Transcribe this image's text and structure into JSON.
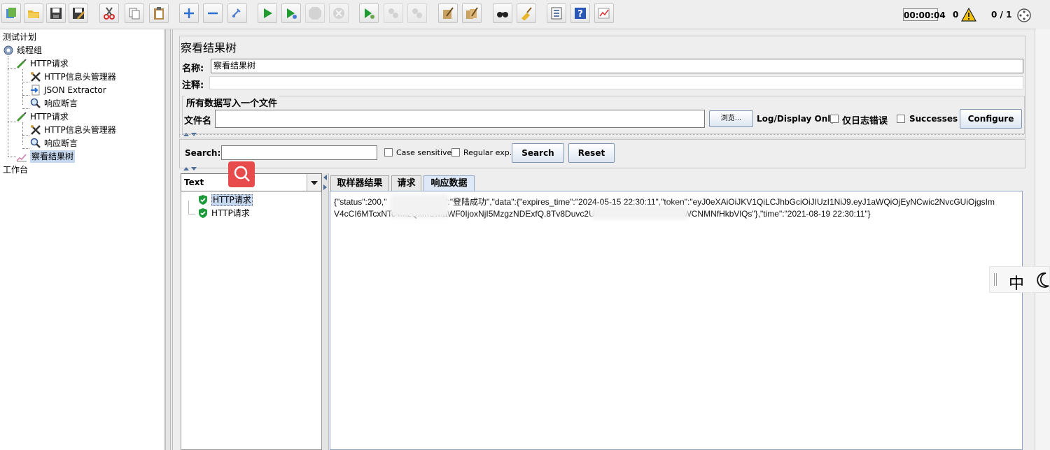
{
  "toolbar": {
    "buttons": [
      "new-icon",
      "open-icon",
      "save-icon",
      "save-as-icon",
      "cut-icon",
      "copy-icon",
      "paste-icon",
      "expand-icon",
      "collapse-icon",
      "toggle-icon",
      "start-icon",
      "start-no-pause-icon",
      "stop-icon",
      "shutdown-icon",
      "remote-start-icon",
      "remote-stop-icon",
      "remote-shutdown-icon",
      "clear-icon",
      "clear-all-icon",
      "search-icon",
      "reset-search-icon",
      "function-helper-icon",
      "help-icon",
      "log-viewer-icon"
    ],
    "timer": "00:00:04",
    "error_count": "0",
    "threads": "0 / 1"
  },
  "tree": {
    "items": [
      {
        "label": "测试计划",
        "icon": "test-plan-icon"
      },
      {
        "label": "线程组",
        "icon": "gear-icon"
      },
      {
        "label": "HTTP请求",
        "icon": "pipette-icon"
      },
      {
        "label": "HTTP信息头管理器",
        "icon": "tools-icon"
      },
      {
        "label": "JSON Extractor",
        "icon": "arrow-doc-icon"
      },
      {
        "label": "响应断言",
        "icon": "magnifier-icon"
      },
      {
        "label": "HTTP请求",
        "icon": "pipette-icon"
      },
      {
        "label": "HTTP信息头管理器",
        "icon": "tools-icon"
      },
      {
        "label": "响应断言",
        "icon": "magnifier-icon"
      },
      {
        "label": "察看结果树",
        "icon": "chart-icon"
      },
      {
        "label": "工作台",
        "icon": ""
      }
    ]
  },
  "panel": {
    "title": "察看结果树",
    "name_label": "名称:",
    "name_value": "察看结果树",
    "comment_label": "注释:",
    "file_section": "所有数据写入一个文件",
    "filename_label": "文件名",
    "browse_label": "浏览...",
    "log_only_label": "Log/Display Only:",
    "errors_only_label": "仅日志错误",
    "successes_label": "Successes",
    "configure_label": "Configure"
  },
  "search": {
    "label": "Search:",
    "case_label": "Case sensitive",
    "regex_label": "Regular exp.",
    "search_btn": "Search",
    "reset_btn": "Reset"
  },
  "results": {
    "renderer": "Text",
    "samples": [
      "HTTP请求",
      "HTTP请求"
    ],
    "tabs": [
      "取样器结果",
      "请求",
      "响应数据"
    ],
    "response_line1": "{\"status\":200,\"                  msg\":\"登陆成功\",\"data\":{\"expires_time\":\"2024-05-15 22:30:11\",\"token\":\"eyJ0eXAiOiJKV1QiLCJhbGciOiJIUzI1NiJ9.eyJ1aWQiOjEyNCwic2NvcGUiOjgsIm",
    "response_line2": "V4cCI6MTcxNTc4MzQxMSwiaWF0IjoxNjI5MzgzNDExfQ.8Tv8Duvc2U                                      WCNMNfHkbVlQs\"},\"time\":\"2021-08-19 22:30:11\"}"
  },
  "ime": {
    "label": "中"
  },
  "colors": {
    "accent": "#e84b4b",
    "selection": "#c6d8ef"
  }
}
